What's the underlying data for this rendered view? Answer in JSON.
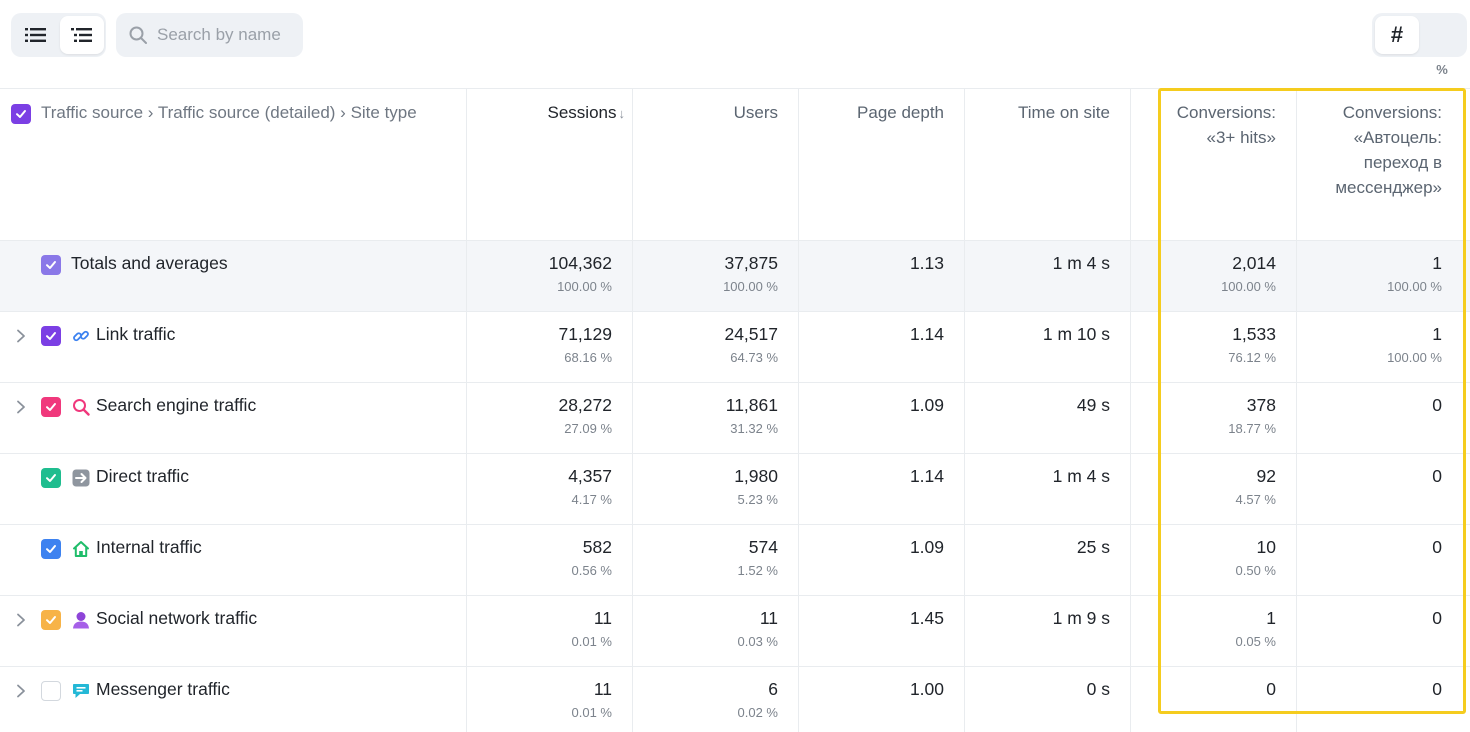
{
  "toolbar": {
    "search_placeholder": "Search by name",
    "hash_label": "#",
    "percent_label": "%"
  },
  "header": {
    "dimensions": "Traffic source › Traffic source (detailed) › Site type",
    "sessions": "Sessions",
    "sort_arrow": "↓",
    "users": "Users",
    "page_depth": "Page depth",
    "time_on_site": "Time on site",
    "conv1_line1": "Conversions:",
    "conv1_line2": "«3+ hits»",
    "conv2_line1": "Conversions:",
    "conv2_line2": "«Автоцель:",
    "conv2_line3": "переход в",
    "conv2_line4": "мессенджер»"
  },
  "colors": {
    "highlight": "#f5cc1e",
    "header_checkbox": "#7b3fe4",
    "totals_checkbox": "#8a78e8",
    "link": "#7b3fe4",
    "search": "#f0387c",
    "direct": "#1fbd8f",
    "internal": "#3d82f0",
    "social": "#f7b347",
    "messenger": "#ffffff"
  },
  "rows": [
    {
      "label": "Totals and averages",
      "icon": "",
      "sessions": "104,362",
      "sessions_pct": "100.00 %",
      "users": "37,875",
      "users_pct": "100.00 %",
      "depth": "1.13",
      "time": "1 m 4 s",
      "conv1": "2,014",
      "conv1_pct": "100.00 %",
      "conv2": "1",
      "conv2_pct": "100.00 %"
    },
    {
      "label": "Link traffic",
      "icon": "link-icon",
      "sessions": "71,129",
      "sessions_pct": "68.16 %",
      "users": "24,517",
      "users_pct": "64.73 %",
      "depth": "1.14",
      "time": "1 m 10 s",
      "conv1": "1,533",
      "conv1_pct": "76.12 %",
      "conv2": "1",
      "conv2_pct": "100.00 %"
    },
    {
      "label": "Search engine traffic",
      "icon": "search-engine-icon",
      "sessions": "28,272",
      "sessions_pct": "27.09 %",
      "users": "11,861",
      "users_pct": "31.32 %",
      "depth": "1.09",
      "time": "49 s",
      "conv1": "378",
      "conv1_pct": "18.77 %",
      "conv2": "0",
      "conv2_pct": ""
    },
    {
      "label": "Direct traffic",
      "icon": "direct-icon",
      "sessions": "4,357",
      "sessions_pct": "4.17 %",
      "users": "1,980",
      "users_pct": "5.23 %",
      "depth": "1.14",
      "time": "1 m 4 s",
      "conv1": "92",
      "conv1_pct": "4.57 %",
      "conv2": "0",
      "conv2_pct": ""
    },
    {
      "label": "Internal traffic",
      "icon": "home-icon",
      "sessions": "582",
      "sessions_pct": "0.56 %",
      "users": "574",
      "users_pct": "1.52 %",
      "depth": "1.09",
      "time": "25 s",
      "conv1": "10",
      "conv1_pct": "0.50 %",
      "conv2": "0",
      "conv2_pct": ""
    },
    {
      "label": "Social network traffic",
      "icon": "person-icon",
      "sessions": "11",
      "sessions_pct": "0.01 %",
      "users": "11",
      "users_pct": "0.03 %",
      "depth": "1.45",
      "time": "1 m 9 s",
      "conv1": "1",
      "conv1_pct": "0.05 %",
      "conv2": "0",
      "conv2_pct": ""
    },
    {
      "label": "Messenger traffic",
      "icon": "chat-bubble-icon",
      "sessions": "11",
      "sessions_pct": "0.01 %",
      "users": "6",
      "users_pct": "0.02 %",
      "depth": "1.00",
      "time": "0 s",
      "conv1": "0",
      "conv1_pct": "",
      "conv2": "0",
      "conv2_pct": ""
    }
  ]
}
